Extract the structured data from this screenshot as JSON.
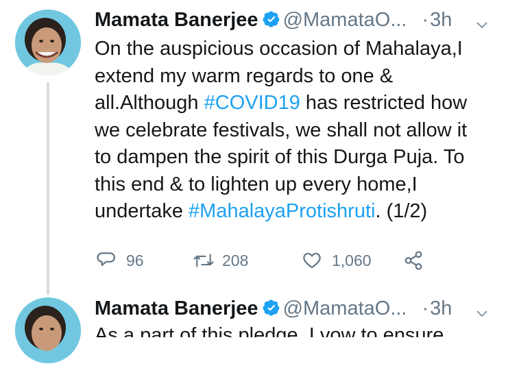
{
  "tweets": [
    {
      "name": "Mamata Banerjee",
      "handle": "@MamataO...",
      "separator": "·",
      "time": "3h",
      "lines": [
        [
          {
            "t": "On the auspicious occasion of Mahalaya,I",
            "h": false
          }
        ],
        [
          {
            "t": "extend my warm regards to one &",
            "h": false
          }
        ],
        [
          {
            "t": "all.Although ",
            "h": false
          },
          {
            "t": "#COVID19",
            "h": true
          },
          {
            "t": " has restricted how",
            "h": false
          }
        ],
        [
          {
            "t": "we celebrate festivals, we shall not allow it",
            "h": false
          }
        ],
        [
          {
            "t": "to dampen the spirit of this Durga Puja. To",
            "h": false
          }
        ],
        [
          {
            "t": "this end & to lighten up every home,I",
            "h": false
          }
        ],
        [
          {
            "t": "undertake ",
            "h": false
          },
          {
            "t": "#MahalayaProtishruti",
            "h": true
          },
          {
            "t": ". (1/2)",
            "h": false
          }
        ]
      ],
      "actions": {
        "reply_count": "96",
        "retweet_count": "208",
        "like_count": "1,060"
      }
    },
    {
      "name": "Mamata Banerjee",
      "handle": "@MamataO...",
      "separator": "·",
      "time": "3h",
      "partial_line": "As a part of this pledge, I vow to ensure"
    }
  ],
  "colors": {
    "text": "#14171a",
    "secondary": "#657786",
    "link": "#1da1f2",
    "verified": "#1da1f2",
    "thread_line": "#d6dde3"
  },
  "icons": {
    "verified": "verified-badge-icon",
    "caret": "chevron-down-icon",
    "reply": "reply-icon",
    "retweet": "retweet-icon",
    "like": "heart-icon",
    "share": "share-icon"
  }
}
